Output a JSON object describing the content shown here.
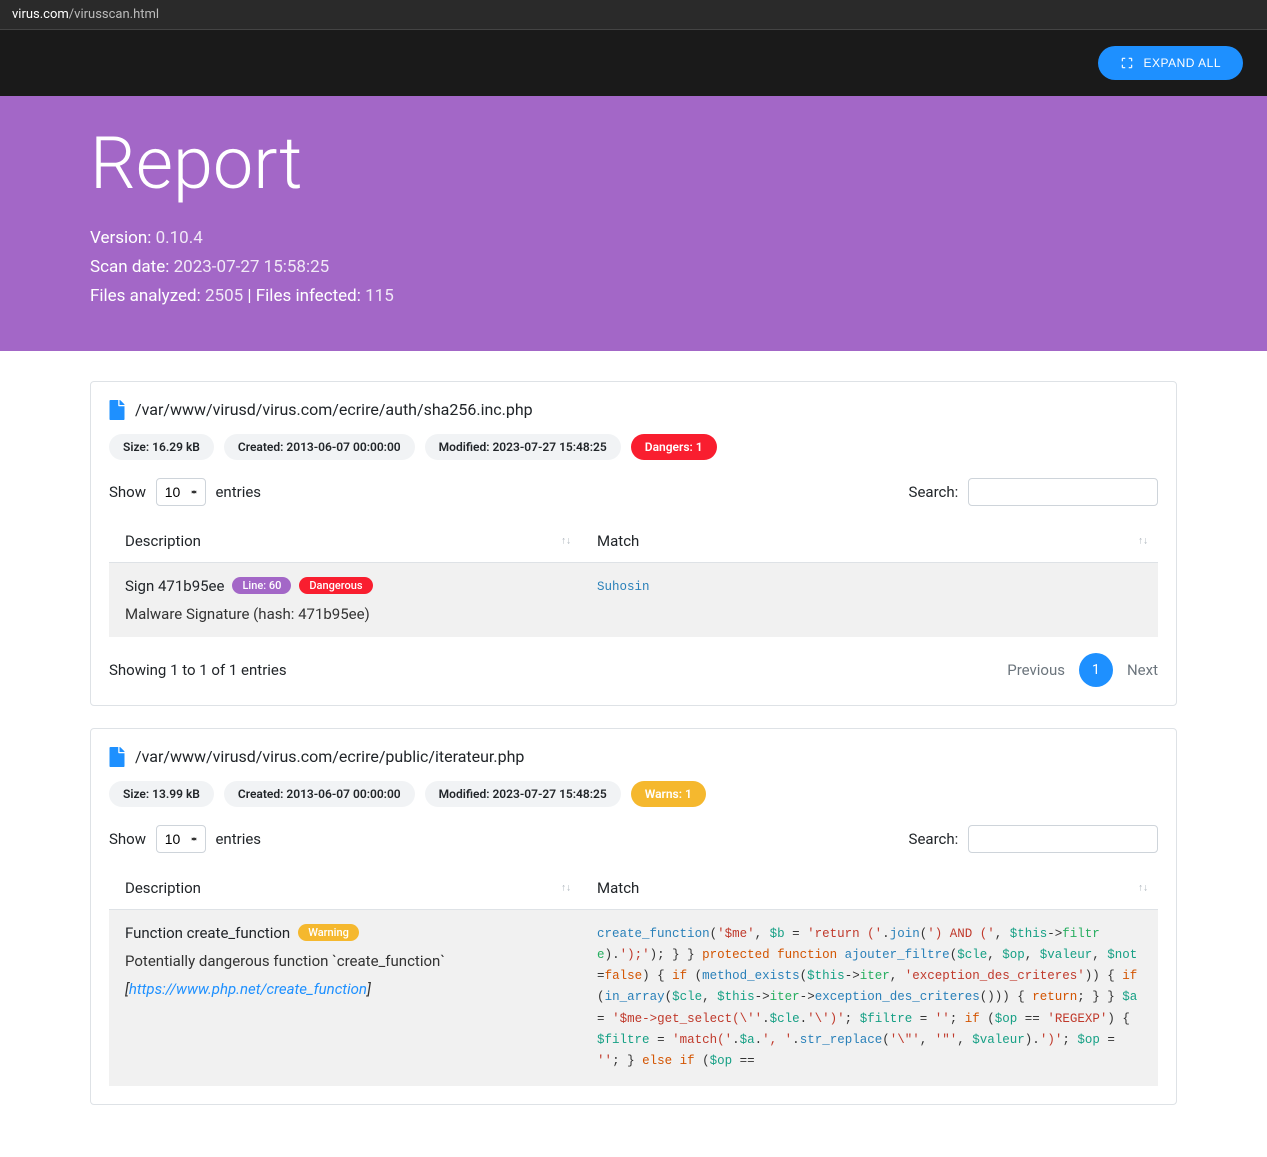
{
  "url": {
    "domain": "virus.com",
    "path": "/virusscan.html"
  },
  "toolbar": {
    "expand_label": "EXPAND ALL"
  },
  "hero": {
    "title": "Report",
    "version_label": "Version:",
    "version_value": "0.10.4",
    "scandate_label": "Scan date:",
    "scandate_value": "2023-07-27 15:58:25",
    "analyzed_label": "Files analyzed:",
    "analyzed_value": "2505",
    "infected_label": "Files infected:",
    "infected_value": "115",
    "separator": " | "
  },
  "table_common": {
    "show_label": "Show",
    "entries_label": "entries",
    "per_page": "10",
    "search_label": "Search:",
    "col_description": "Description",
    "col_match": "Match",
    "showing_text": "Showing 1 to 1 of 1 entries",
    "prev": "Previous",
    "next": "Next",
    "page": "1"
  },
  "files": [
    {
      "path": "/var/www/virusd/virus.com/ecrire/auth/sha256.inc.php",
      "badges": {
        "size": "Size: 16.29 kB",
        "created": "Created: 2013-06-07 00:00:00",
        "modified": "Modified: 2023-07-27 15:48:25",
        "danger": "Dangers: 1"
      },
      "row": {
        "title": "Sign 471b95ee",
        "line": "Line: 60",
        "severity": "Dangerous",
        "sub": "Malware Signature (hash: 471b95ee)",
        "match": "Suhosin"
      }
    },
    {
      "path": "/var/www/virusd/virus.com/ecrire/public/iterateur.php",
      "badges": {
        "size": "Size: 13.99 kB",
        "created": "Created: 2013-06-07 00:00:00",
        "modified": "Modified: 2023-07-27 15:48:25",
        "warn": "Warns: 1"
      },
      "row": {
        "title": "Function create_function",
        "severity": "Warning",
        "sub1": "Potentially dangerous function `create_function`",
        "link_text": "https://www.php.net/create_function",
        "match_tokens": [
          {
            "t": "fn",
            "v": "create_function"
          },
          {
            "t": "punc",
            "v": "("
          },
          {
            "t": "str",
            "v": "'$me'"
          },
          {
            "t": "punc",
            "v": ", "
          },
          {
            "t": "var",
            "v": "$b"
          },
          {
            "t": "punc",
            "v": " = "
          },
          {
            "t": "str",
            "v": "'return ('"
          },
          {
            "t": "punc",
            "v": "."
          },
          {
            "t": "fn",
            "v": "join"
          },
          {
            "t": "punc",
            "v": "("
          },
          {
            "t": "str",
            "v": "') AND ('"
          },
          {
            "t": "punc",
            "v": ", "
          },
          {
            "t": "var",
            "v": "$this"
          },
          {
            "t": "punc",
            "v": "-"
          },
          {
            "t": "punc",
            "v": ">"
          },
          {
            "t": "cls",
            "v": "filtre"
          },
          {
            "t": "punc",
            "v": ")."
          },
          {
            "t": "str",
            "v": "');'"
          },
          {
            "t": "punc",
            "v": "); } } "
          },
          {
            "t": "kw",
            "v": "protected function"
          },
          {
            "t": "punc",
            "v": " "
          },
          {
            "t": "fn",
            "v": "ajouter_filtre"
          },
          {
            "t": "punc",
            "v": "("
          },
          {
            "t": "var",
            "v": "$cle"
          },
          {
            "t": "punc",
            "v": ", "
          },
          {
            "t": "var",
            "v": "$op"
          },
          {
            "t": "punc",
            "v": ", "
          },
          {
            "t": "var",
            "v": "$valeur"
          },
          {
            "t": "punc",
            "v": ", "
          },
          {
            "t": "var",
            "v": "$not"
          },
          {
            "t": "punc",
            "v": "="
          },
          {
            "t": "kw",
            "v": "false"
          },
          {
            "t": "punc",
            "v": ") { "
          },
          {
            "t": "kw",
            "v": "if"
          },
          {
            "t": "punc",
            "v": " ("
          },
          {
            "t": "fn",
            "v": "method_exists"
          },
          {
            "t": "punc",
            "v": "("
          },
          {
            "t": "var",
            "v": "$this"
          },
          {
            "t": "punc",
            "v": "-"
          },
          {
            "t": "punc",
            "v": ">"
          },
          {
            "t": "cls",
            "v": "iter"
          },
          {
            "t": "punc",
            "v": ", "
          },
          {
            "t": "str",
            "v": "'exception_des_criteres'"
          },
          {
            "t": "punc",
            "v": ")) { "
          },
          {
            "t": "kw",
            "v": "if"
          },
          {
            "t": "punc",
            "v": " ("
          },
          {
            "t": "fn",
            "v": "in_array"
          },
          {
            "t": "punc",
            "v": "("
          },
          {
            "t": "var",
            "v": "$cle"
          },
          {
            "t": "punc",
            "v": ", "
          },
          {
            "t": "var",
            "v": "$this"
          },
          {
            "t": "punc",
            "v": "->"
          },
          {
            "t": "cls",
            "v": "iter"
          },
          {
            "t": "punc",
            "v": "-"
          },
          {
            "t": "punc",
            "v": ">"
          },
          {
            "t": "fn",
            "v": "exception_des_criteres"
          },
          {
            "t": "punc",
            "v": "())) { "
          },
          {
            "t": "kw",
            "v": "return"
          },
          {
            "t": "punc",
            "v": "; } } "
          },
          {
            "t": "var",
            "v": "$a"
          },
          {
            "t": "punc",
            "v": " = "
          },
          {
            "t": "str",
            "v": "'$me-"
          },
          {
            "t": "str",
            "v": ">get_select(\\''"
          },
          {
            "t": "punc",
            "v": "."
          },
          {
            "t": "var",
            "v": "$cle"
          },
          {
            "t": "punc",
            "v": "."
          },
          {
            "t": "str",
            "v": "'\\')'"
          },
          {
            "t": "punc",
            "v": "; "
          },
          {
            "t": "var",
            "v": "$filtre"
          },
          {
            "t": "punc",
            "v": " = "
          },
          {
            "t": "str",
            "v": "''"
          },
          {
            "t": "punc",
            "v": "; "
          },
          {
            "t": "kw",
            "v": "if"
          },
          {
            "t": "punc",
            "v": " ("
          },
          {
            "t": "var",
            "v": "$op"
          },
          {
            "t": "punc",
            "v": " == "
          },
          {
            "t": "str",
            "v": "'REGEXP'"
          },
          {
            "t": "punc",
            "v": ") { "
          },
          {
            "t": "var",
            "v": "$filtre"
          },
          {
            "t": "punc",
            "v": " = "
          },
          {
            "t": "str",
            "v": "'ma"
          },
          {
            "t": "str",
            "v": "tch('"
          },
          {
            "t": "punc",
            "v": "."
          },
          {
            "t": "var",
            "v": "$a"
          },
          {
            "t": "punc",
            "v": "."
          },
          {
            "t": "str",
            "v": "', '"
          },
          {
            "t": "punc",
            "v": "."
          },
          {
            "t": "fn",
            "v": "str_replace"
          },
          {
            "t": "punc",
            "v": "("
          },
          {
            "t": "str",
            "v": "'\\\"'"
          },
          {
            "t": "punc",
            "v": ", "
          },
          {
            "t": "str",
            "v": "'\"'"
          },
          {
            "t": "punc",
            "v": ", "
          },
          {
            "t": "var",
            "v": "$valeur"
          },
          {
            "t": "punc",
            "v": ")."
          },
          {
            "t": "str",
            "v": "')'"
          },
          {
            "t": "punc",
            "v": "; "
          },
          {
            "t": "var",
            "v": "$op"
          },
          {
            "t": "punc",
            "v": " = "
          },
          {
            "t": "str",
            "v": "''"
          },
          {
            "t": "punc",
            "v": "; } "
          },
          {
            "t": "kw",
            "v": "else if"
          },
          {
            "t": "punc",
            "v": " ("
          },
          {
            "t": "var",
            "v": "$op"
          },
          {
            "t": "punc",
            "v": " =="
          }
        ]
      }
    }
  ]
}
